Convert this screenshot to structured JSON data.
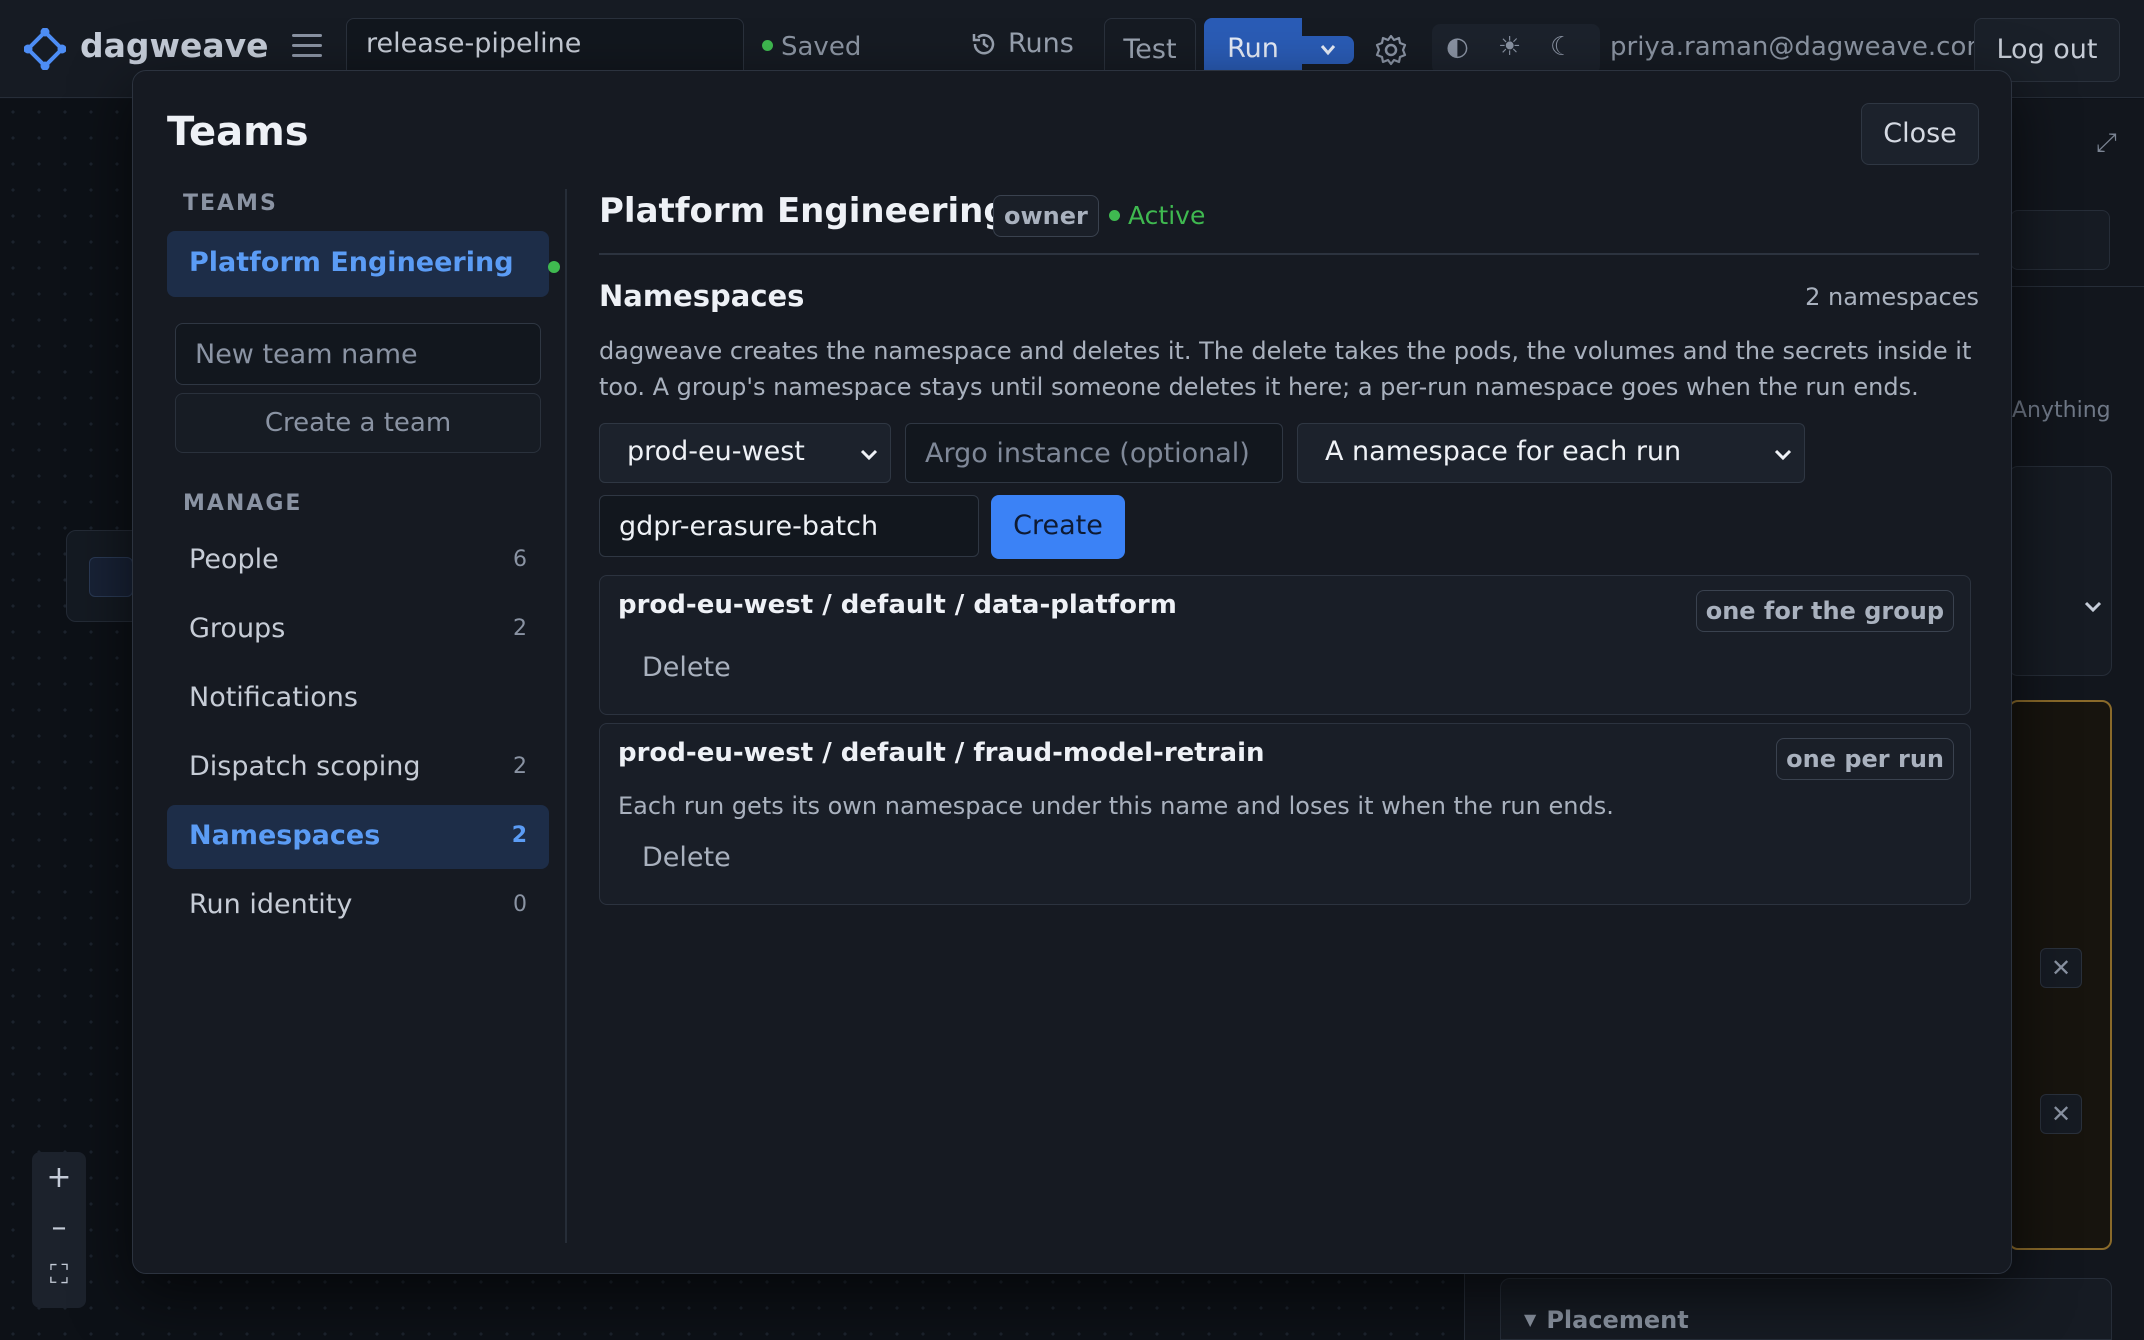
{
  "app": {
    "logo_text": "dagweave",
    "pipeline_name": "release-pipeline",
    "save_status": "Saved",
    "user_email": "priya.raman@dagweave.com"
  },
  "toolbar": {
    "runs_label": "Runs",
    "test_label": "Test",
    "run_label": "Run",
    "logout_label": "Log out",
    "theme_icons": [
      "half-circle-icon",
      "sun-icon",
      "moon-icon"
    ]
  },
  "background": {
    "right_panel_hint": "Anything",
    "placement_label": "Placement"
  },
  "modal": {
    "title": "Teams",
    "close_label": "Close",
    "sidebar": {
      "teams_heading": "TEAMS",
      "teams": [
        {
          "label": "Platform Engineering",
          "active": true,
          "status_color": "#3fb950"
        }
      ],
      "new_team_placeholder": "New team name",
      "create_team_label": "Create a team",
      "manage_heading": "MANAGE",
      "manage_items": [
        {
          "label": "People",
          "count": "6",
          "active": false
        },
        {
          "label": "Groups",
          "count": "2",
          "active": false
        },
        {
          "label": "Notifications",
          "count": "",
          "active": false
        },
        {
          "label": "Dispatch scoping",
          "count": "2",
          "active": false
        },
        {
          "label": "Namespaces",
          "count": "2",
          "active": true
        },
        {
          "label": "Run identity",
          "count": "0",
          "active": false
        }
      ]
    },
    "content": {
      "team_name": "Platform Engineering",
      "role_badge": "owner",
      "status": "Active",
      "section_title": "Namespaces",
      "namespace_count": "2 namespaces",
      "description": "dagweave creates the namespace and deletes it. The delete takes the pods, the volumes and the secrets inside it too. A group's namespace stays until someone deletes it here; a per-run namespace goes when the run ends.",
      "form": {
        "cluster_selected": "prod-eu-west",
        "argo_placeholder": "Argo instance (optional)",
        "mode_selected": "A namespace for each run",
        "name_value": "gdpr-erasure-batch",
        "create_label": "Create"
      },
      "namespaces": [
        {
          "path": "prod-eu-west / default / data-platform",
          "mode": "one for the group",
          "note": "",
          "delete_label": "Delete"
        },
        {
          "path": "prod-eu-west / default / fraud-model-retrain",
          "mode": "one per run",
          "note": "Each run gets its own namespace under this name and loses it when the run ends.",
          "delete_label": "Delete"
        }
      ]
    }
  },
  "colors": {
    "accent": "#3b82f6",
    "accent_text": "#5b9cf5",
    "success": "#3fb950",
    "warning_border": "#8a6a2a"
  }
}
